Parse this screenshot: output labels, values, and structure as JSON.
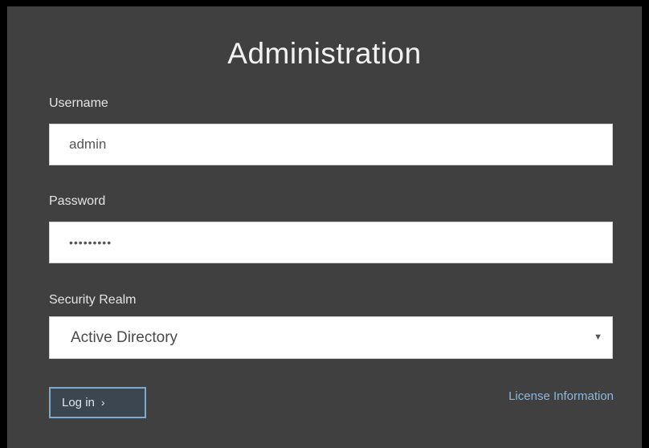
{
  "title": "Administration",
  "username": {
    "label": "Username",
    "value": "admin"
  },
  "password": {
    "label": "Password",
    "value": "•••••••••"
  },
  "security_realm": {
    "label": "Security Realm",
    "selected": "Active Directory",
    "arrow": "▼"
  },
  "login_button": {
    "label": "Log in",
    "chevron": "›"
  },
  "license_link": "License Information",
  "colors": {
    "background": "#404040",
    "link": "#8cb6e0",
    "button_border": "#7fa9cf"
  }
}
